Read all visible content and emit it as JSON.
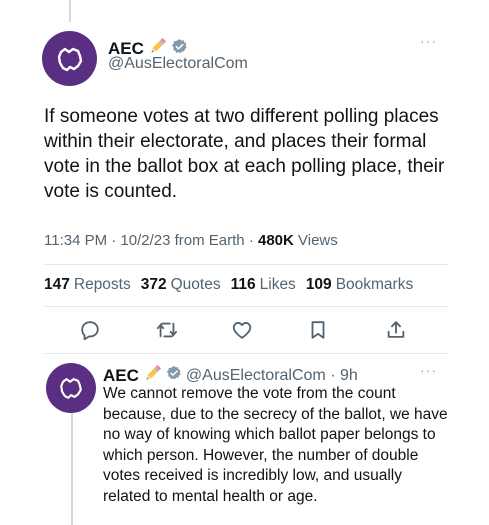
{
  "main_tweet": {
    "display_name": "AEC",
    "handle": "@AusElectoralCom",
    "more_label": "···",
    "text": "If someone votes at two different polling places within their electorate, and places their formal vote in the ballot box at each polling place, their vote is counted.",
    "time_date": "11:34 PM · 10/2/23 from Earth · ",
    "views_count": "480K",
    "views_label": " Views"
  },
  "stats": {
    "reposts_count": "147",
    "reposts_label": "Reposts",
    "quotes_count": "372",
    "quotes_label": "Quotes",
    "likes_count": "116",
    "likes_label": "Likes",
    "bookmarks_count": "109",
    "bookmarks_label": "Bookmarks"
  },
  "actions": {
    "icons": [
      "reply-icon",
      "repost-icon",
      "like-icon",
      "bookmark-icon",
      "share-icon"
    ]
  },
  "reply_tweet": {
    "display_name": "AEC",
    "handle_time": "@AusElectoralCom · 9h",
    "more_label": "···",
    "text": "We cannot remove the vote from the count because, due to the secrecy of the ballot, we have no way of knowing which ballot paper belongs to which person. However, the number of double votes received is incredibly low, and usually related to mental health or age."
  },
  "colors": {
    "avatar_bg": "#5a2e82",
    "text": "#0f1419",
    "secondary": "#536471",
    "verified": "#829aab",
    "pencil_body": "#f7c44c",
    "divider": "#e7eaec"
  }
}
